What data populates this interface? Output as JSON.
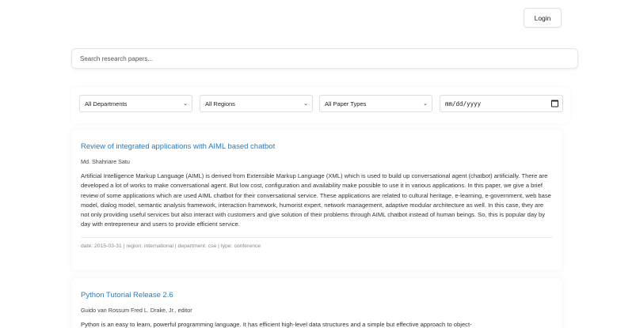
{
  "header": {
    "login_label": "Login"
  },
  "search": {
    "placeholder": "Search research papers..."
  },
  "filters": {
    "department": "All Departments",
    "region": "All Regions",
    "paper_type": "All Paper Types",
    "date_placeholder": "mm/dd/yyyy"
  },
  "papers": [
    {
      "title": "Review of integrated applications with AIML based chatbot",
      "authors": "Md. Shahriare Satu",
      "abstract": "Artificial Intelligence Markup Language (AIML) is derived from Extensible Markup Language (XML) which is used to build up conversational agent (chatbot) artificially. There are developed a lot of works to make conversational agent. But low cost, configuration and availability make possible to use it in various applications. In this paper, we give a brief review of some applications which are used AIML chatbot for their conversational service. These applications are related to cultural heritage, e-learning, e-government, web base model, dialog model, semantic analysis framework, interaction framework, humorist expert, network management, adaptive modular architecture as well. In this case, they are not only providing useful services but also interact with customers and give solution of their problems through AIML chatbot instead of human beings. So, this is popular day by day with entrepreneur and users to provide efficient service.",
      "meta": "date: 2015-03-31 | region: international | department: cse | type: conference"
    },
    {
      "title": "Python Tutorial Release 2.6",
      "authors": "Guido van Rossum Fred L. Drake, Jr., editor",
      "abstract": "Python is an easy to learn, powerful programming language. It has efficient high-level data structures and a simple but effective approach to object-",
      "meta": ""
    }
  ]
}
